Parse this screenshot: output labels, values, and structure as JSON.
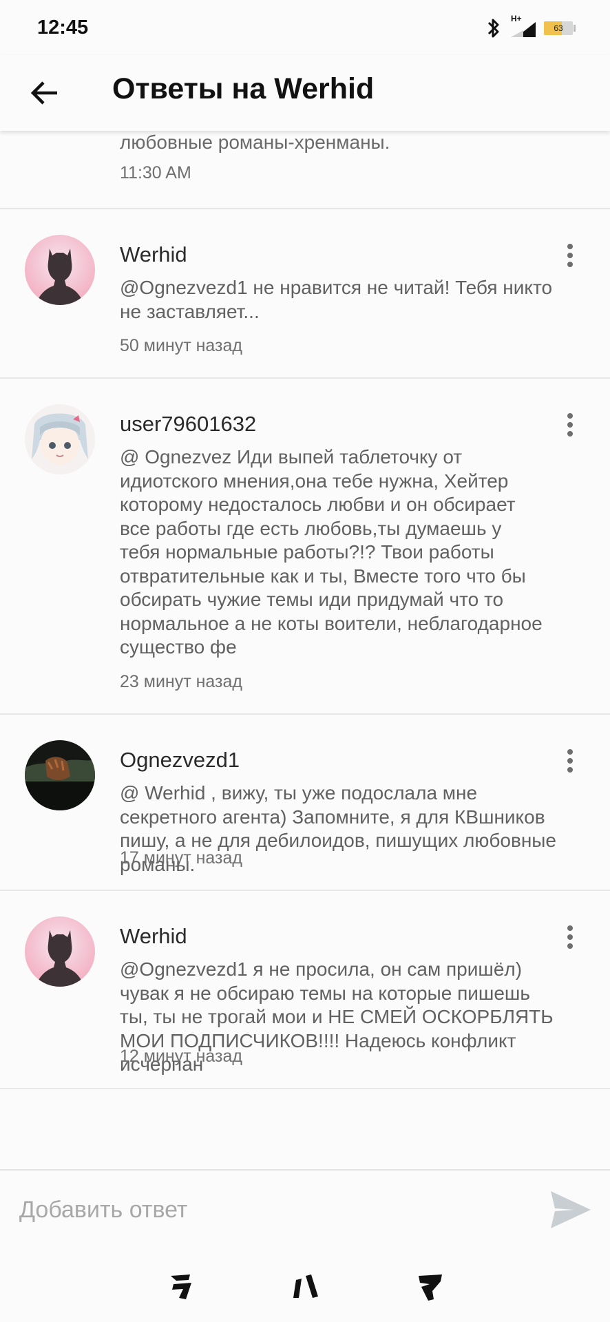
{
  "status_bar": {
    "time": "12:45",
    "network": "H+",
    "battery": "63",
    "battery_level": 0.63
  },
  "header": {
    "title": "Ответы на Werhid"
  },
  "partial_reply": {
    "text": "любовные романы-хренманы.",
    "time": "11:30 AM"
  },
  "replies": [
    {
      "author": "Werhid",
      "message": "@Ognezvezd1  не нравится не читай! Тебя никто\nне заставляет...",
      "time": "50 минут назад"
    },
    {
      "author": "user79601632",
      "message": "@ Ognezvez Иди выпей таблеточку от\nидиотского мнения,она тебе нужна, Хейтер\nкоторому недосталось любви и он обсирает\nвсе работы где есть любовь,ты думаешь у\nтебя нормальные работы?!? Твои работы\nотвратительные как и ты, Вместе того что бы\nобсирать чужие темы иди придумай что то\nнормальное а не коты воители, неблагодарное\nсущество фе",
      "time": "23 минут назад"
    },
    {
      "author": "Ognezvezd1",
      "message": "@ Werhid , вижу, ты уже подослала мне\nсекретного агента) Запомните, я для КВшников\nпишу, а не для дебилоидов, пишущих любовные\nроманы.",
      "time": "17 минут назад"
    },
    {
      "author": "Werhid",
      "message": "@Ognezvezd1  я не просила, он сам пришёл)\nчувак я не обсираю темы на которые пишешь\nты, ты не трогай мои и НЕ СМЕЙ ОСКОРБЛЯТЬ\nМОИ ПОДПИСЧИКОВ!!!! Надеюсь конфликт\nисчерпан",
      "time": "12 минут назад"
    }
  ],
  "input": {
    "placeholder": "Добавить ответ"
  },
  "icons": {
    "back": "arrow-left-icon",
    "more": "more-vertical-icon",
    "send": "send-icon",
    "nav": [
      "nav-back-icon",
      "nav-home-icon",
      "nav-recent-icon"
    ]
  },
  "colors": {
    "background": "#fcfbfc",
    "text_primary": "#111111",
    "text_secondary": "#616161",
    "divider": "#e6e6e6",
    "send": "#c9ced3"
  }
}
